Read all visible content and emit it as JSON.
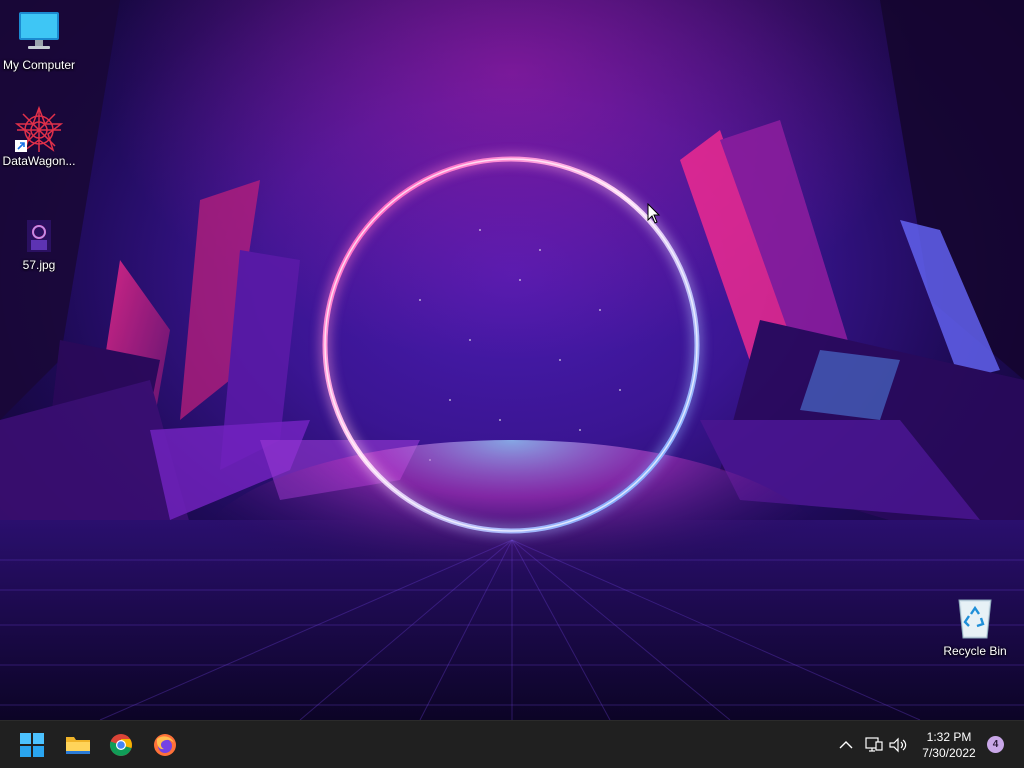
{
  "desktop": {
    "icons": [
      {
        "label": "My Computer",
        "icon": "monitor-icon"
      },
      {
        "label": "DataWagon...",
        "icon": "datawagon-shortcut-icon"
      },
      {
        "label": "57.jpg",
        "icon": "image-file-icon"
      },
      {
        "label": "Recycle Bin",
        "icon": "recycle-bin-icon"
      }
    ],
    "wallpaper": "neon-ring-wallpaper"
  },
  "taskbar": {
    "pinned": [
      {
        "name": "Start",
        "icon": "windows-start-icon"
      },
      {
        "name": "File Explorer",
        "icon": "folder-icon"
      },
      {
        "name": "Google Chrome",
        "icon": "chrome-icon"
      },
      {
        "name": "Firefox",
        "icon": "firefox-icon"
      }
    ],
    "tray": {
      "icons": [
        "chevron-up-icon",
        "network-icon",
        "volume-icon"
      ],
      "time": "1:32 PM",
      "date": "7/30/2022",
      "notification_count": "4"
    }
  },
  "colors": {
    "taskbar_bg": "#202020",
    "ring_pink": "#ff3fb0",
    "ring_blue": "#5fa0ff"
  }
}
